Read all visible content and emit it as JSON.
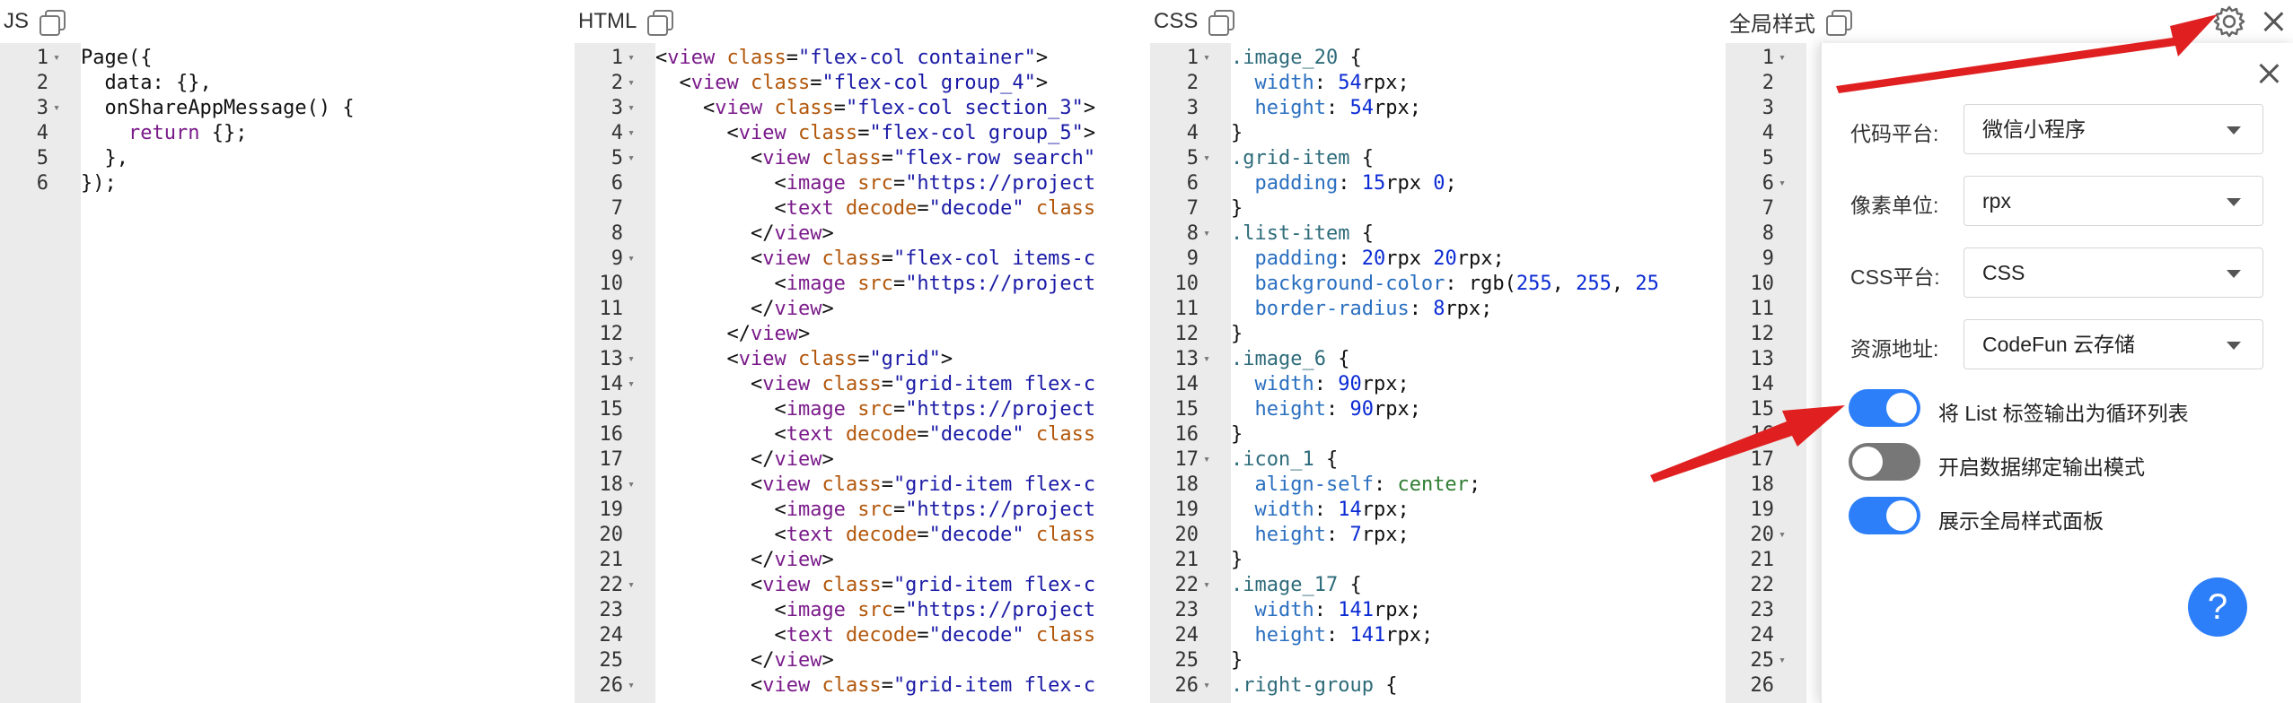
{
  "panes": {
    "js": {
      "title": "JS",
      "lines": [
        {
          "n": "1",
          "f": "▾",
          "h": "Page({"
        },
        {
          "n": "2",
          "f": "",
          "h": "  data: {},"
        },
        {
          "n": "3",
          "f": "▾",
          "h": "  onShareAppMessage() {"
        },
        {
          "n": "4",
          "f": "",
          "h": "    <span class=\"k-kw\">return</span> {};"
        },
        {
          "n": "5",
          "f": "",
          "h": "  },"
        },
        {
          "n": "6",
          "f": "",
          "h": "});"
        }
      ]
    },
    "html": {
      "title": "HTML",
      "lines": [
        {
          "n": "1",
          "f": "▾",
          "h": "&lt;<span class=\"k-tag\">view</span> <span class=\"k-attr\">class</span>=<span class=\"k-str\">\"flex-col container\"</span>&gt;"
        },
        {
          "n": "2",
          "f": "▾",
          "h": "  &lt;<span class=\"k-tag\">view</span> <span class=\"k-attr\">class</span>=<span class=\"k-str\">\"flex-col group_4\"</span>&gt;"
        },
        {
          "n": "3",
          "f": "▾",
          "h": "    &lt;<span class=\"k-tag\">view</span> <span class=\"k-attr\">class</span>=<span class=\"k-str\">\"flex-col section_3\"</span>&gt;"
        },
        {
          "n": "4",
          "f": "▾",
          "h": "      &lt;<span class=\"k-tag\">view</span> <span class=\"k-attr\">class</span>=<span class=\"k-str\">\"flex-col group_5\"</span>&gt;"
        },
        {
          "n": "5",
          "f": "▾",
          "h": "        &lt;<span class=\"k-tag\">view</span> <span class=\"k-attr\">class</span>=<span class=\"k-str\">\"flex-row search\"</span>"
        },
        {
          "n": "6",
          "f": "",
          "h": "          &lt;<span class=\"k-tag\">image</span> <span class=\"k-attr\">src</span>=<span class=\"k-str\">\"https://project</span>"
        },
        {
          "n": "7",
          "f": "",
          "h": "          &lt;<span class=\"k-tag\">text</span> <span class=\"k-attr\">decode</span>=<span class=\"k-str\">\"decode\"</span> <span class=\"k-attr\">class</span>"
        },
        {
          "n": "8",
          "f": "",
          "h": "        &lt;/<span class=\"k-tag\">view</span>&gt;"
        },
        {
          "n": "9",
          "f": "▾",
          "h": "        &lt;<span class=\"k-tag\">view</span> <span class=\"k-attr\">class</span>=<span class=\"k-str\">\"flex-col items-c</span>"
        },
        {
          "n": "10",
          "f": "",
          "h": "          &lt;<span class=\"k-tag\">image</span> <span class=\"k-attr\">src</span>=<span class=\"k-str\">\"https://project</span>"
        },
        {
          "n": "11",
          "f": "",
          "h": "        &lt;/<span class=\"k-tag\">view</span>&gt;"
        },
        {
          "n": "12",
          "f": "",
          "h": "      &lt;/<span class=\"k-tag\">view</span>&gt;"
        },
        {
          "n": "13",
          "f": "▾",
          "h": "      &lt;<span class=\"k-tag\">view</span> <span class=\"k-attr\">class</span>=<span class=\"k-str\">\"grid\"</span>&gt;"
        },
        {
          "n": "14",
          "f": "▾",
          "h": "        &lt;<span class=\"k-tag\">view</span> <span class=\"k-attr\">class</span>=<span class=\"k-str\">\"grid-item flex-c</span>"
        },
        {
          "n": "15",
          "f": "",
          "h": "          &lt;<span class=\"k-tag\">image</span> <span class=\"k-attr\">src</span>=<span class=\"k-str\">\"https://project</span>"
        },
        {
          "n": "16",
          "f": "",
          "h": "          &lt;<span class=\"k-tag\">text</span> <span class=\"k-attr\">decode</span>=<span class=\"k-str\">\"decode\"</span> <span class=\"k-attr\">class</span>"
        },
        {
          "n": "17",
          "f": "",
          "h": "        &lt;/<span class=\"k-tag\">view</span>&gt;"
        },
        {
          "n": "18",
          "f": "▾",
          "h": "        &lt;<span class=\"k-tag\">view</span> <span class=\"k-attr\">class</span>=<span class=\"k-str\">\"grid-item flex-c</span>"
        },
        {
          "n": "19",
          "f": "",
          "h": "          &lt;<span class=\"k-tag\">image</span> <span class=\"k-attr\">src</span>=<span class=\"k-str\">\"https://project</span>"
        },
        {
          "n": "20",
          "f": "",
          "h": "          &lt;<span class=\"k-tag\">text</span> <span class=\"k-attr\">decode</span>=<span class=\"k-str\">\"decode\"</span> <span class=\"k-attr\">class</span>"
        },
        {
          "n": "21",
          "f": "",
          "h": "        &lt;/<span class=\"k-tag\">view</span>&gt;"
        },
        {
          "n": "22",
          "f": "▾",
          "h": "        &lt;<span class=\"k-tag\">view</span> <span class=\"k-attr\">class</span>=<span class=\"k-str\">\"grid-item flex-c</span>"
        },
        {
          "n": "23",
          "f": "",
          "h": "          &lt;<span class=\"k-tag\">image</span> <span class=\"k-attr\">src</span>=<span class=\"k-str\">\"https://project</span>"
        },
        {
          "n": "24",
          "f": "",
          "h": "          &lt;<span class=\"k-tag\">text</span> <span class=\"k-attr\">decode</span>=<span class=\"k-str\">\"decode\"</span> <span class=\"k-attr\">class</span>"
        },
        {
          "n": "25",
          "f": "",
          "h": "        &lt;/<span class=\"k-tag\">view</span>&gt;"
        },
        {
          "n": "26",
          "f": "▾",
          "h": "        &lt;<span class=\"k-tag\">view</span> <span class=\"k-attr\">class</span>=<span class=\"k-str\">\"grid-item flex-c</span>"
        }
      ]
    },
    "css": {
      "title": "CSS",
      "lines": [
        {
          "n": "1",
          "f": "▾",
          "h": "<span class=\"k-sel\">.image_20</span> {"
        },
        {
          "n": "2",
          "f": "",
          "h": "  <span class=\"k-prop\">width</span>: <span class=\"k-num\">54</span>rpx;"
        },
        {
          "n": "3",
          "f": "",
          "h": "  <span class=\"k-prop\">height</span>: <span class=\"k-num\">54</span>rpx;"
        },
        {
          "n": "4",
          "f": "",
          "h": "}"
        },
        {
          "n": "5",
          "f": "▾",
          "h": "<span class=\"k-sel\">.grid-item</span> {"
        },
        {
          "n": "6",
          "f": "",
          "h": "  <span class=\"k-prop\">padding</span>: <span class=\"k-num\">15</span>rpx <span class=\"k-num\">0</span>;"
        },
        {
          "n": "7",
          "f": "",
          "h": "}"
        },
        {
          "n": "8",
          "f": "▾",
          "h": "<span class=\"k-sel\">.list-item</span> {"
        },
        {
          "n": "9",
          "f": "",
          "h": "  <span class=\"k-prop\">padding</span>: <span class=\"k-num\">20</span>rpx <span class=\"k-num\">20</span>rpx;"
        },
        {
          "n": "10",
          "f": "",
          "h": "  <span class=\"k-prop\">background-color</span>: rgb(<span class=\"k-num\">255</span>, <span class=\"k-num\">255</span>, <span class=\"k-num\">25</span>"
        },
        {
          "n": "11",
          "f": "",
          "h": "  <span class=\"k-prop\">border-radius</span>: <span class=\"k-num\">8</span>rpx;"
        },
        {
          "n": "12",
          "f": "",
          "h": "}"
        },
        {
          "n": "13",
          "f": "▾",
          "h": "<span class=\"k-sel\">.image_6</span> {"
        },
        {
          "n": "14",
          "f": "",
          "h": "  <span class=\"k-prop\">width</span>: <span class=\"k-num\">90</span>rpx;"
        },
        {
          "n": "15",
          "f": "",
          "h": "  <span class=\"k-prop\">height</span>: <span class=\"k-num\">90</span>rpx;"
        },
        {
          "n": "16",
          "f": "",
          "h": "}"
        },
        {
          "n": "17",
          "f": "▾",
          "h": "<span class=\"k-sel\">.icon_1</span> {"
        },
        {
          "n": "18",
          "f": "",
          "h": "  <span class=\"k-prop\">align-self</span>: <span class=\"k-val\">center</span>;"
        },
        {
          "n": "19",
          "f": "",
          "h": "  <span class=\"k-prop\">width</span>: <span class=\"k-num\">14</span>rpx;"
        },
        {
          "n": "20",
          "f": "",
          "h": "  <span class=\"k-prop\">height</span>: <span class=\"k-num\">7</span>rpx;"
        },
        {
          "n": "21",
          "f": "",
          "h": "}"
        },
        {
          "n": "22",
          "f": "▾",
          "h": "<span class=\"k-sel\">.image_17</span> {"
        },
        {
          "n": "23",
          "f": "",
          "h": "  <span class=\"k-prop\">width</span>: <span class=\"k-num\">141</span>rpx;"
        },
        {
          "n": "24",
          "f": "",
          "h": "  <span class=\"k-prop\">height</span>: <span class=\"k-num\">141</span>rpx;"
        },
        {
          "n": "25",
          "f": "",
          "h": "}"
        },
        {
          "n": "26",
          "f": "▾",
          "h": "<span class=\"k-sel\">.right-group</span> {"
        }
      ]
    },
    "global": {
      "title": "全局样式",
      "lines": [
        {
          "n": "1",
          "f": "▾"
        },
        {
          "n": "2",
          "f": ""
        },
        {
          "n": "3",
          "f": ""
        },
        {
          "n": "4",
          "f": ""
        },
        {
          "n": "5",
          "f": ""
        },
        {
          "n": "6",
          "f": "▾"
        },
        {
          "n": "7",
          "f": ""
        },
        {
          "n": "8",
          "f": ""
        },
        {
          "n": "9",
          "f": ""
        },
        {
          "n": "10",
          "f": ""
        },
        {
          "n": "11",
          "f": ""
        },
        {
          "n": "12",
          "f": ""
        },
        {
          "n": "13",
          "f": ""
        },
        {
          "n": "14",
          "f": ""
        },
        {
          "n": "15",
          "f": ""
        },
        {
          "n": "16",
          "f": ""
        },
        {
          "n": "17",
          "f": ""
        },
        {
          "n": "18",
          "f": ""
        },
        {
          "n": "19",
          "f": ""
        },
        {
          "n": "20",
          "f": "▾"
        },
        {
          "n": "21",
          "f": ""
        },
        {
          "n": "22",
          "f": ""
        },
        {
          "n": "23",
          "f": ""
        },
        {
          "n": "24",
          "f": ""
        },
        {
          "n": "25",
          "f": "▾"
        },
        {
          "n": "26",
          "f": ""
        }
      ]
    }
  },
  "settings": {
    "platform": {
      "label": "代码平台:",
      "value": "微信小程序"
    },
    "unit": {
      "label": "像素单位:",
      "value": "rpx"
    },
    "css_platform": {
      "label": "CSS平台:",
      "value": "CSS"
    },
    "resource": {
      "label": "资源地址:",
      "value": "CodeFun 云存储"
    },
    "toggles": [
      {
        "label": "将 List 标签输出为循环列表",
        "on": true
      },
      {
        "label": "开启数据绑定输出模式",
        "on": false
      },
      {
        "label": "展示全局样式面板",
        "on": true
      }
    ],
    "help_glyph": "?"
  },
  "icons": {
    "settings": "gear-icon",
    "close": "close-icon",
    "copy": "copy-icon",
    "help": "help-icon"
  },
  "colors": {
    "toggle_on": "#2d7ff9",
    "toggle_off": "#777777",
    "arrow": "#e02020",
    "gutter": "#ebebeb"
  }
}
